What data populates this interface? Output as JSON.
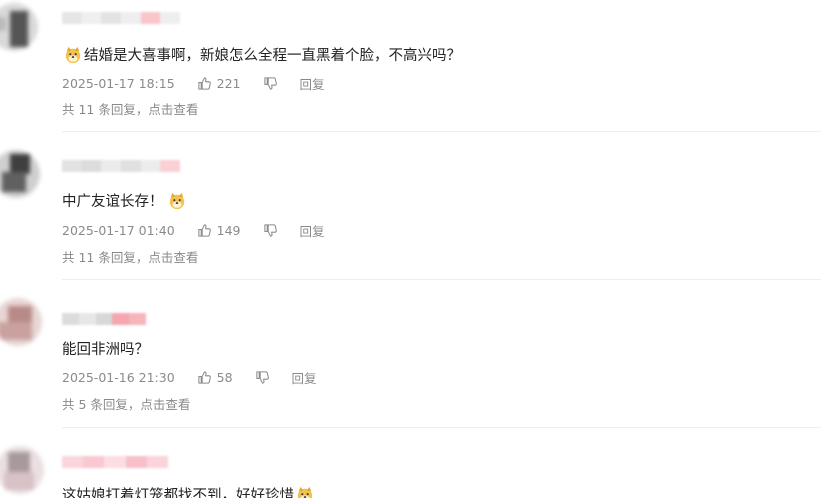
{
  "comments": [
    {
      "text_before": "",
      "text": "结婚是大喜事啊，新娘怎么全程一直黑着个脸，不高兴吗？",
      "emoji_lead": "doge-emoji",
      "time": "2025-01-17 18:15",
      "likes": "221",
      "reply_label": "回复",
      "replies_text": "共 11 条回复，点击查看"
    },
    {
      "text": "中广友谊长存！",
      "emoji_trail": "doge-emoji",
      "time": "2025-01-17 01:40",
      "likes": "149",
      "reply_label": "回复",
      "replies_text": "共 11 条回复，点击查看"
    },
    {
      "text": "能回非洲吗？",
      "time": "2025-01-16 21:30",
      "likes": "58",
      "reply_label": "回复",
      "replies_text": "共 5 条回复，点击查看"
    },
    {
      "text": "这姑娘打着灯笼都找不到，好好珍惜",
      "emoji_trail": "doge-emoji"
    }
  ],
  "colors": {
    "text": "#222222",
    "meta": "#8a8a8a",
    "divider": "#eeeeee",
    "blur_pink": "#f4a7ae"
  }
}
